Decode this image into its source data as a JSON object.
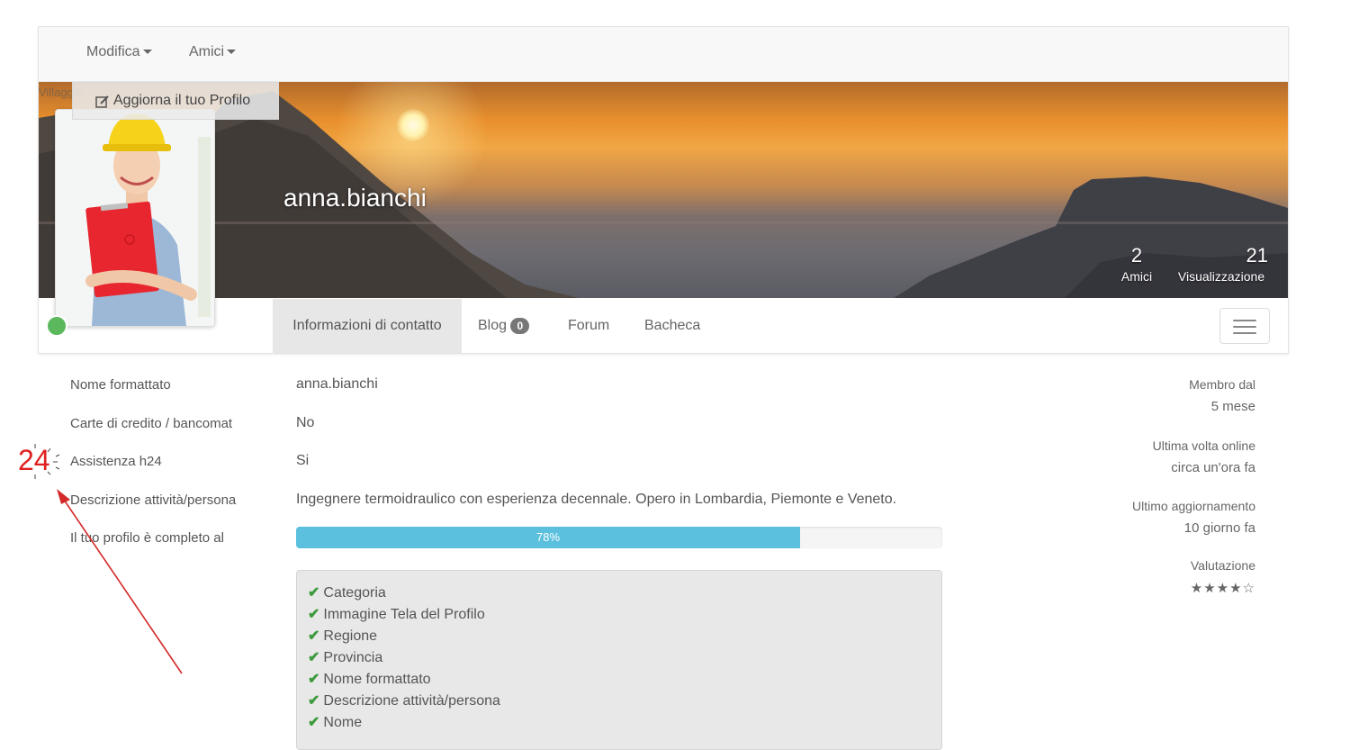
{
  "topnav": {
    "edit_label": "Modifica",
    "friends_label": "Amici"
  },
  "update_profile_label": "Aggiorna il tuo Profilo",
  "ghost_text": "Villaggio",
  "profile": {
    "username": "anna.bianchi"
  },
  "stats": {
    "friends": {
      "count": "2",
      "label": "Amici"
    },
    "views": {
      "count": "21",
      "label": "Visualizzazione"
    }
  },
  "tabs": {
    "contact": "Informazioni di contatto",
    "blog": "Blog",
    "blog_count": "0",
    "forum": "Forum",
    "board": "Bacheca"
  },
  "fields": [
    {
      "label": "Nome formattato",
      "value": "anna.bianchi"
    },
    {
      "label": "Carte di credito / bancomat",
      "value": "No"
    },
    {
      "label": "Assistenza h24",
      "value": "Si"
    },
    {
      "label": "Descrizione attività/persona",
      "value": "Ingegnere termoidraulico con esperienza decennale. Opero in Lombardia, Piemonte e Veneto."
    },
    {
      "label": "Il tuo profilo è completo al",
      "value": ""
    }
  ],
  "completion": {
    "percent_label": "78%",
    "fraction": 0.78
  },
  "checklist": [
    "Categoria",
    "Immagine Tela del Profilo",
    "Regione",
    "Provincia",
    "Nome formattato",
    "Descrizione attività/persona",
    "Nome"
  ],
  "sidebar": {
    "member_since_label": "Membro dal",
    "member_since_value": "5 mese",
    "last_online_label": "Ultima volta online",
    "last_online_value": "circa un'ora fa",
    "last_update_label": "Ultimo aggiornamento",
    "last_update_value": "10 giorno fa",
    "rating_label": "Valutazione",
    "rating_stars": "★★★★☆",
    "rating_value": 4,
    "rating_max": 5
  },
  "annotation": {
    "number": "24",
    "color": "#e02020"
  },
  "colors": {
    "progress": "#5bc0de",
    "check": "#3c9a3c",
    "online": "#5cb85c"
  }
}
